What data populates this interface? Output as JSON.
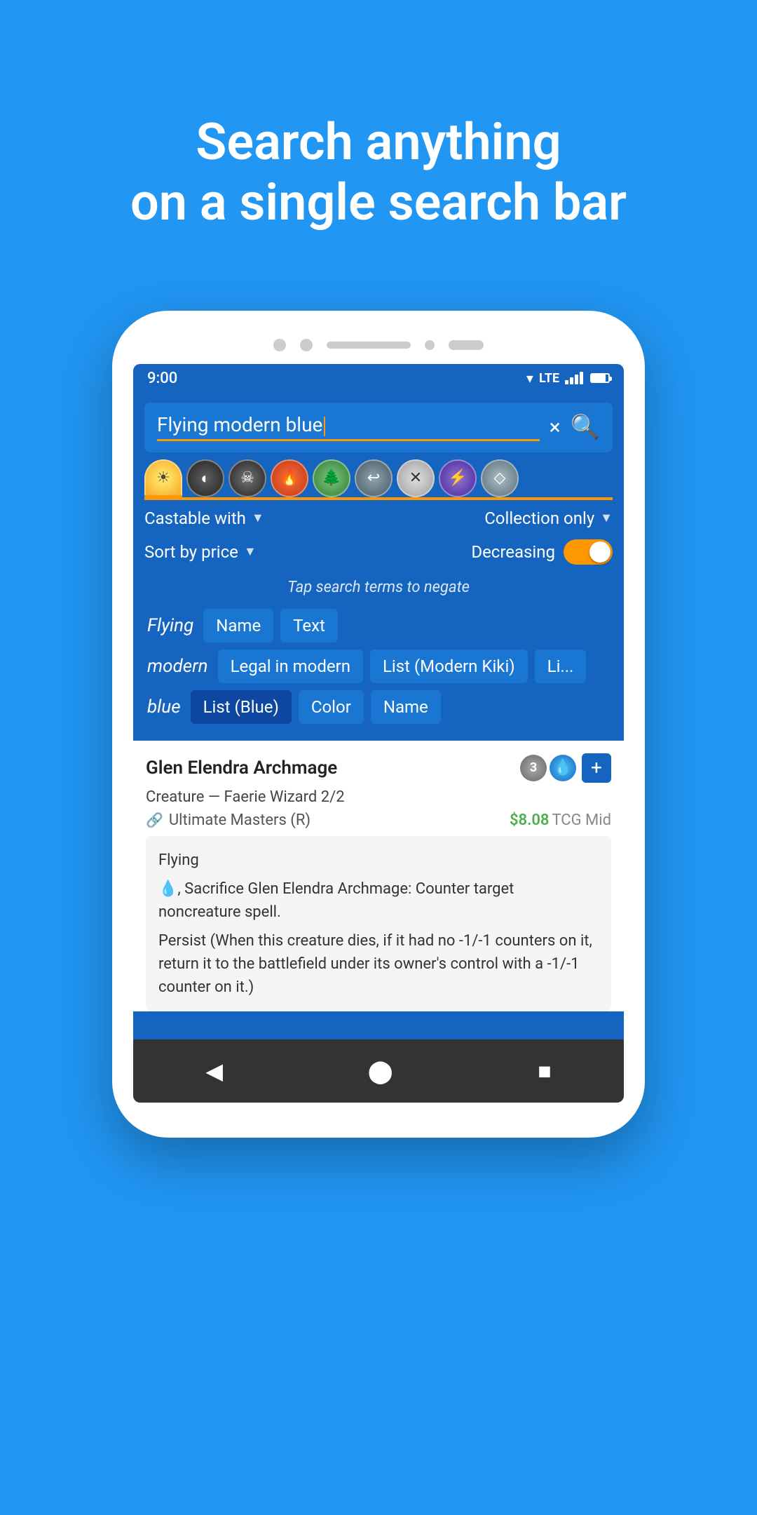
{
  "headline": {
    "line1": "Search anything",
    "line2": "on a single search bar"
  },
  "status_bar": {
    "time": "9:00",
    "lte": "LTE"
  },
  "search": {
    "query": "Flying modern blue",
    "clear_label": "×",
    "search_label": "🔍"
  },
  "filters": {
    "castable_label": "Castable with",
    "collection_label": "Collection only",
    "sort_label": "Sort by price",
    "sort_direction": "Decreasing",
    "toggle_on": true
  },
  "hint": "Tap search terms to negate",
  "tags": {
    "rows": [
      {
        "keyword": "Flying",
        "chips": [
          "Name",
          "Text"
        ]
      },
      {
        "keyword": "modern",
        "chips": [
          "Legal in modern",
          "List (Modern Kiki)",
          "Li..."
        ]
      },
      {
        "keyword": "blue",
        "chips": [
          "List (Blue)",
          "Color",
          "Name"
        ]
      }
    ]
  },
  "card": {
    "name": "Glen Elendra Archmage",
    "mana": [
      "3",
      "U"
    ],
    "type": "Creature — Faerie Wizard 2/2",
    "set": "Ultimate Masters (R)",
    "price": "$8.08",
    "price_label": "TCG Mid",
    "oracle_text": "Flying\n🔵, Sacrifice Glen Elendra Archmage: Counter target noncreature spell.\nPersist (When this creature dies, if it had no -1/-1 counters on it, return it to the battlefield under its owner's control with a -1/-1 counter on it.)"
  },
  "nav": {
    "back": "◀",
    "home": "⬤",
    "recent": "■"
  },
  "mana_symbols": [
    {
      "type": "sun",
      "char": "☀"
    },
    {
      "type": "moon",
      "char": "◐"
    },
    {
      "type": "skull",
      "char": "☠"
    },
    {
      "type": "fire",
      "char": "🔥"
    },
    {
      "type": "tree",
      "char": "🌳"
    },
    {
      "type": "arrow",
      "char": "↩"
    },
    {
      "type": "x",
      "char": "✕"
    },
    {
      "type": "bolt",
      "char": "⚡"
    },
    {
      "type": "diamond",
      "char": "◇"
    }
  ]
}
